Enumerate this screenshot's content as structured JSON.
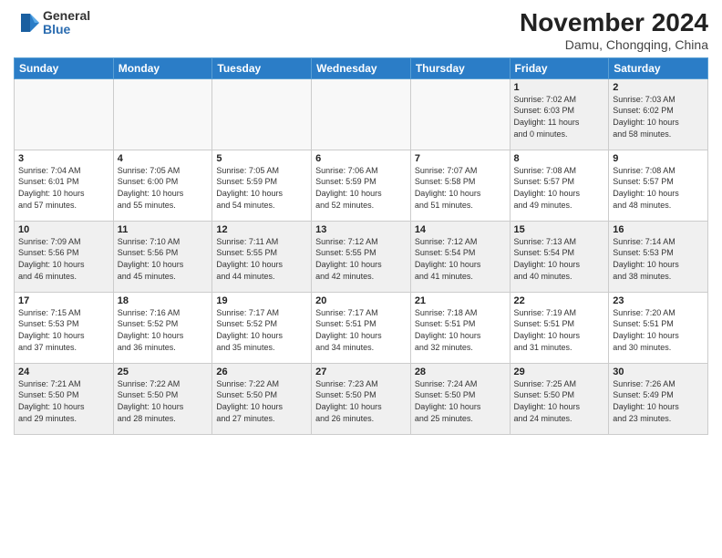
{
  "header": {
    "logo_general": "General",
    "logo_blue": "Blue",
    "month_title": "November 2024",
    "location": "Damu, Chongqing, China"
  },
  "days_of_week": [
    "Sunday",
    "Monday",
    "Tuesday",
    "Wednesday",
    "Thursday",
    "Friday",
    "Saturday"
  ],
  "rows": [
    [
      {
        "day": "",
        "info": ""
      },
      {
        "day": "",
        "info": ""
      },
      {
        "day": "",
        "info": ""
      },
      {
        "day": "",
        "info": ""
      },
      {
        "day": "",
        "info": ""
      },
      {
        "day": "1",
        "info": "Sunrise: 7:02 AM\nSunset: 6:03 PM\nDaylight: 11 hours\nand 0 minutes."
      },
      {
        "day": "2",
        "info": "Sunrise: 7:03 AM\nSunset: 6:02 PM\nDaylight: 10 hours\nand 58 minutes."
      }
    ],
    [
      {
        "day": "3",
        "info": "Sunrise: 7:04 AM\nSunset: 6:01 PM\nDaylight: 10 hours\nand 57 minutes."
      },
      {
        "day": "4",
        "info": "Sunrise: 7:05 AM\nSunset: 6:00 PM\nDaylight: 10 hours\nand 55 minutes."
      },
      {
        "day": "5",
        "info": "Sunrise: 7:05 AM\nSunset: 5:59 PM\nDaylight: 10 hours\nand 54 minutes."
      },
      {
        "day": "6",
        "info": "Sunrise: 7:06 AM\nSunset: 5:59 PM\nDaylight: 10 hours\nand 52 minutes."
      },
      {
        "day": "7",
        "info": "Sunrise: 7:07 AM\nSunset: 5:58 PM\nDaylight: 10 hours\nand 51 minutes."
      },
      {
        "day": "8",
        "info": "Sunrise: 7:08 AM\nSunset: 5:57 PM\nDaylight: 10 hours\nand 49 minutes."
      },
      {
        "day": "9",
        "info": "Sunrise: 7:08 AM\nSunset: 5:57 PM\nDaylight: 10 hours\nand 48 minutes."
      }
    ],
    [
      {
        "day": "10",
        "info": "Sunrise: 7:09 AM\nSunset: 5:56 PM\nDaylight: 10 hours\nand 46 minutes."
      },
      {
        "day": "11",
        "info": "Sunrise: 7:10 AM\nSunset: 5:56 PM\nDaylight: 10 hours\nand 45 minutes."
      },
      {
        "day": "12",
        "info": "Sunrise: 7:11 AM\nSunset: 5:55 PM\nDaylight: 10 hours\nand 44 minutes."
      },
      {
        "day": "13",
        "info": "Sunrise: 7:12 AM\nSunset: 5:55 PM\nDaylight: 10 hours\nand 42 minutes."
      },
      {
        "day": "14",
        "info": "Sunrise: 7:12 AM\nSunset: 5:54 PM\nDaylight: 10 hours\nand 41 minutes."
      },
      {
        "day": "15",
        "info": "Sunrise: 7:13 AM\nSunset: 5:54 PM\nDaylight: 10 hours\nand 40 minutes."
      },
      {
        "day": "16",
        "info": "Sunrise: 7:14 AM\nSunset: 5:53 PM\nDaylight: 10 hours\nand 38 minutes."
      }
    ],
    [
      {
        "day": "17",
        "info": "Sunrise: 7:15 AM\nSunset: 5:53 PM\nDaylight: 10 hours\nand 37 minutes."
      },
      {
        "day": "18",
        "info": "Sunrise: 7:16 AM\nSunset: 5:52 PM\nDaylight: 10 hours\nand 36 minutes."
      },
      {
        "day": "19",
        "info": "Sunrise: 7:17 AM\nSunset: 5:52 PM\nDaylight: 10 hours\nand 35 minutes."
      },
      {
        "day": "20",
        "info": "Sunrise: 7:17 AM\nSunset: 5:51 PM\nDaylight: 10 hours\nand 34 minutes."
      },
      {
        "day": "21",
        "info": "Sunrise: 7:18 AM\nSunset: 5:51 PM\nDaylight: 10 hours\nand 32 minutes."
      },
      {
        "day": "22",
        "info": "Sunrise: 7:19 AM\nSunset: 5:51 PM\nDaylight: 10 hours\nand 31 minutes."
      },
      {
        "day": "23",
        "info": "Sunrise: 7:20 AM\nSunset: 5:51 PM\nDaylight: 10 hours\nand 30 minutes."
      }
    ],
    [
      {
        "day": "24",
        "info": "Sunrise: 7:21 AM\nSunset: 5:50 PM\nDaylight: 10 hours\nand 29 minutes."
      },
      {
        "day": "25",
        "info": "Sunrise: 7:22 AM\nSunset: 5:50 PM\nDaylight: 10 hours\nand 28 minutes."
      },
      {
        "day": "26",
        "info": "Sunrise: 7:22 AM\nSunset: 5:50 PM\nDaylight: 10 hours\nand 27 minutes."
      },
      {
        "day": "27",
        "info": "Sunrise: 7:23 AM\nSunset: 5:50 PM\nDaylight: 10 hours\nand 26 minutes."
      },
      {
        "day": "28",
        "info": "Sunrise: 7:24 AM\nSunset: 5:50 PM\nDaylight: 10 hours\nand 25 minutes."
      },
      {
        "day": "29",
        "info": "Sunrise: 7:25 AM\nSunset: 5:50 PM\nDaylight: 10 hours\nand 24 minutes."
      },
      {
        "day": "30",
        "info": "Sunrise: 7:26 AM\nSunset: 5:49 PM\nDaylight: 10 hours\nand 23 minutes."
      }
    ]
  ]
}
